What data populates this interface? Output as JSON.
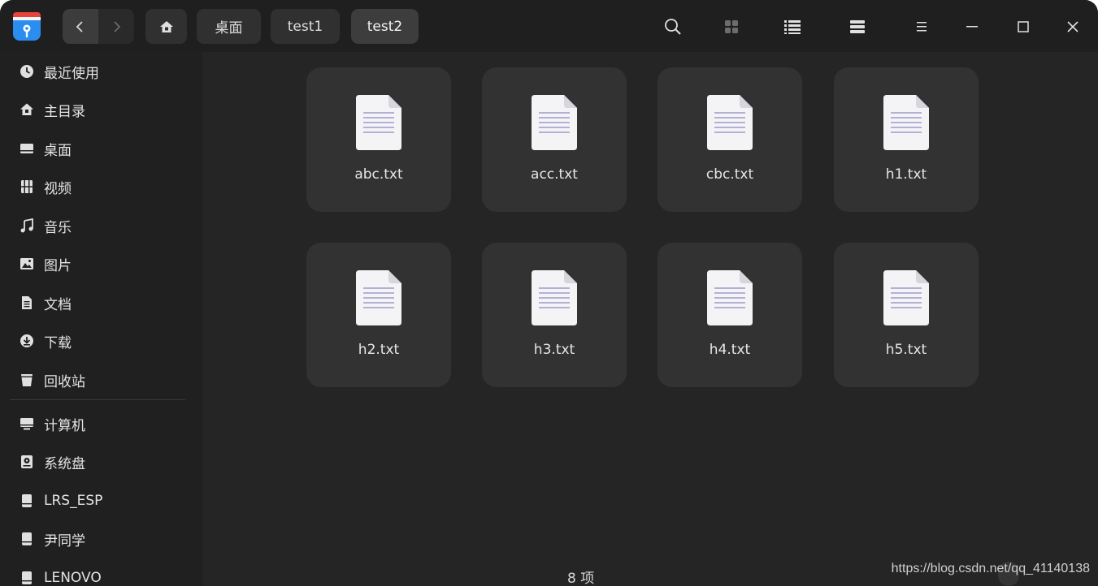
{
  "titlebar": {
    "breadcrumbs": [
      {
        "label": "桌面",
        "active": false
      },
      {
        "label": "test1",
        "active": false
      },
      {
        "label": "test2",
        "active": true
      }
    ],
    "icons": {
      "logo": "file-manager-logo-icon",
      "back": "chevron-left-icon",
      "forward": "chevron-right-icon",
      "home": "home-icon",
      "search": "search-icon",
      "icon_view": "grid-view-icon",
      "list_view": "list-view-icon",
      "tree_view": "tree-view-icon",
      "menu": "menu-icon",
      "minimize": "minimize-icon",
      "maximize": "maximize-icon",
      "close": "close-icon"
    }
  },
  "sidebar": {
    "items": [
      {
        "label": "最近使用",
        "icon": "clock-icon"
      },
      {
        "label": "主目录",
        "icon": "home-icon"
      },
      {
        "label": "桌面",
        "icon": "desktop-icon"
      },
      {
        "label": "视频",
        "icon": "video-icon"
      },
      {
        "label": "音乐",
        "icon": "music-icon"
      },
      {
        "label": "图片",
        "icon": "picture-icon"
      },
      {
        "label": "文档",
        "icon": "document-icon"
      },
      {
        "label": "下载",
        "icon": "download-icon"
      },
      {
        "label": "回收站",
        "icon": "trash-icon"
      }
    ],
    "devices": [
      {
        "label": "计算机",
        "icon": "computer-icon"
      },
      {
        "label": "系统盘",
        "icon": "system-disk-icon"
      },
      {
        "label": "LRS_ESP",
        "icon": "drive-icon"
      },
      {
        "label": "尹同学",
        "icon": "drive-icon"
      },
      {
        "label": "LENOVO",
        "icon": "drive-icon"
      }
    ]
  },
  "files": [
    {
      "name": "abc.txt",
      "icon": "text-file-icon"
    },
    {
      "name": "acc.txt",
      "icon": "text-file-icon"
    },
    {
      "name": "cbc.txt",
      "icon": "text-file-icon"
    },
    {
      "name": "h1.txt",
      "icon": "text-file-icon"
    },
    {
      "name": "h2.txt",
      "icon": "text-file-icon"
    },
    {
      "name": "h3.txt",
      "icon": "text-file-icon"
    },
    {
      "name": "h4.txt",
      "icon": "text-file-icon"
    },
    {
      "name": "h5.txt",
      "icon": "text-file-icon"
    }
  ],
  "status": {
    "item_count": "8 项"
  },
  "watermark": "https://blog.csdn.net/qq_41140138",
  "colors": {
    "window_bg": "#252525",
    "sidebar_bg": "#202020",
    "tile_bg": "#323232",
    "accent_logo": "#2a8ef0"
  }
}
